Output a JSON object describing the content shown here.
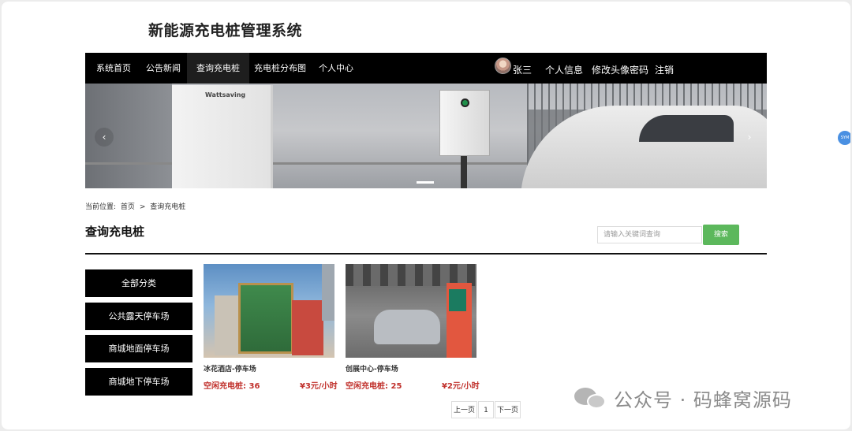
{
  "site": {
    "title": "新能源充电桩管理系统"
  },
  "nav": {
    "items": [
      {
        "label": "系统首页"
      },
      {
        "label": "公告新闻"
      },
      {
        "label": "查询充电桩"
      },
      {
        "label": "充电桩分布图"
      },
      {
        "label": "个人中心"
      }
    ],
    "active_index": 2,
    "user": {
      "name": "张三",
      "profile": "个人信息",
      "change_avatar_password": "修改头像密码",
      "logout": "注销"
    }
  },
  "banner": {
    "brand_text": "Wattsaving",
    "prev_icon": "‹",
    "next_icon": "›"
  },
  "breadcrumb": {
    "prefix": "当前位置:",
    "home": "首页",
    "separator": ">",
    "current": "查询充电桩"
  },
  "page": {
    "title": "查询充电桩"
  },
  "search": {
    "placeholder": "请输入关键词查询",
    "value": "",
    "button": "搜索"
  },
  "categories": [
    "全部分类",
    "公共露天停车场",
    "商城地面停车场",
    "商城地下停车场"
  ],
  "cards": [
    {
      "name": "冰花酒店-停车场",
      "available": "空闲充电桩: 36",
      "price": "¥3元/小时"
    },
    {
      "name": "创展中心-停车场",
      "available": "空闲充电桩: 25",
      "price": "¥2元/小时"
    }
  ],
  "pager": {
    "prev": "上一页",
    "current": "1",
    "next": "下一页"
  },
  "watermark": {
    "text": "公众号 · 码蜂窝源码"
  },
  "side_float": {
    "label": "SYM"
  },
  "colors": {
    "nav_bg": "#000000",
    "search_button": "#5cb85c",
    "price_red": "#c0302b"
  }
}
